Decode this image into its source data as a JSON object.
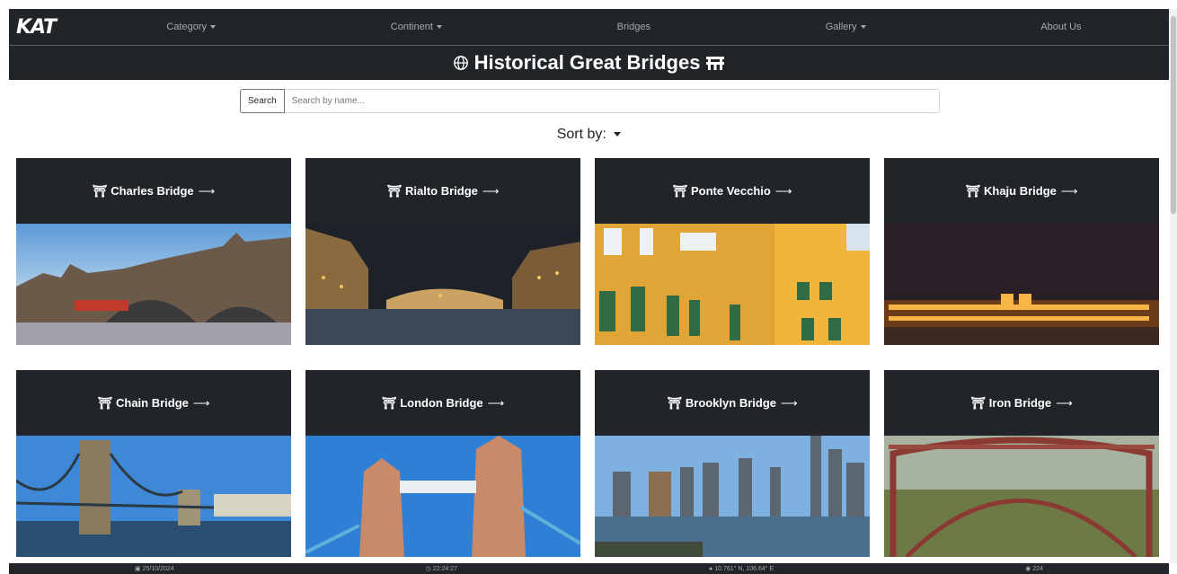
{
  "nav": {
    "logo": "KAT",
    "items": [
      {
        "label": "Category",
        "dropdown": true
      },
      {
        "label": "Continent",
        "dropdown": true
      },
      {
        "label": "Bridges",
        "dropdown": false
      },
      {
        "label": "Gallery",
        "dropdown": true
      },
      {
        "label": "About Us",
        "dropdown": false
      }
    ]
  },
  "header": {
    "title": "Historical Great Bridges",
    "left_icon": "globe-icon",
    "right_icon": "bridge-icon"
  },
  "search": {
    "button_label": "Search",
    "placeholder": "Search by name..."
  },
  "sort": {
    "label": "Sort by:"
  },
  "cards": [
    {
      "name": "Charles Bridge"
    },
    {
      "name": "Rialto Bridge"
    },
    {
      "name": "Ponte Vecchio"
    },
    {
      "name": "Khaju Bridge"
    },
    {
      "name": "Chain Bridge"
    },
    {
      "name": "London Bridge"
    },
    {
      "name": "Brooklyn Bridge"
    },
    {
      "name": "Iron Bridge"
    }
  ],
  "footer": {
    "date": "25/10/2024",
    "time": "22:24:27",
    "location": "10.761° N, 106.64° E",
    "visits": "224"
  },
  "colors": {
    "dark": "#212529",
    "accent_text": "#ffffff",
    "nav_text": "#a6a9ad"
  }
}
